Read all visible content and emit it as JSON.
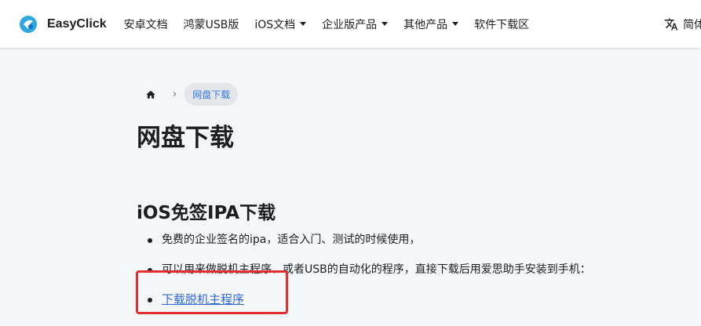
{
  "navbar": {
    "brand": "EasyClick",
    "items": [
      {
        "label": "安卓文档",
        "dropdown": false
      },
      {
        "label": "鸿蒙USB版",
        "dropdown": false
      },
      {
        "label": "iOS文档",
        "dropdown": true
      },
      {
        "label": "企业版产品",
        "dropdown": true
      },
      {
        "label": "其他产品",
        "dropdown": true
      },
      {
        "label": "软件下载区",
        "dropdown": false
      }
    ],
    "language_label": "简体"
  },
  "breadcrumb": {
    "current": "网盘下载"
  },
  "page": {
    "title": "网盘下载",
    "section_title": "iOS免签IPA下载",
    "bullets": [
      "免费的企业签名的ipa，适合入门、测试的时候使用，",
      "可以用来做脱机主程序、或者USB的自动化的程序，直接下载后用爱思助手安装到手机："
    ],
    "link_label": "下载脱机主程序"
  },
  "colors": {
    "accent": "#3578e5",
    "link": "#2e6bd6",
    "highlight_border": "#e03030",
    "background": "#f5f6f7"
  }
}
